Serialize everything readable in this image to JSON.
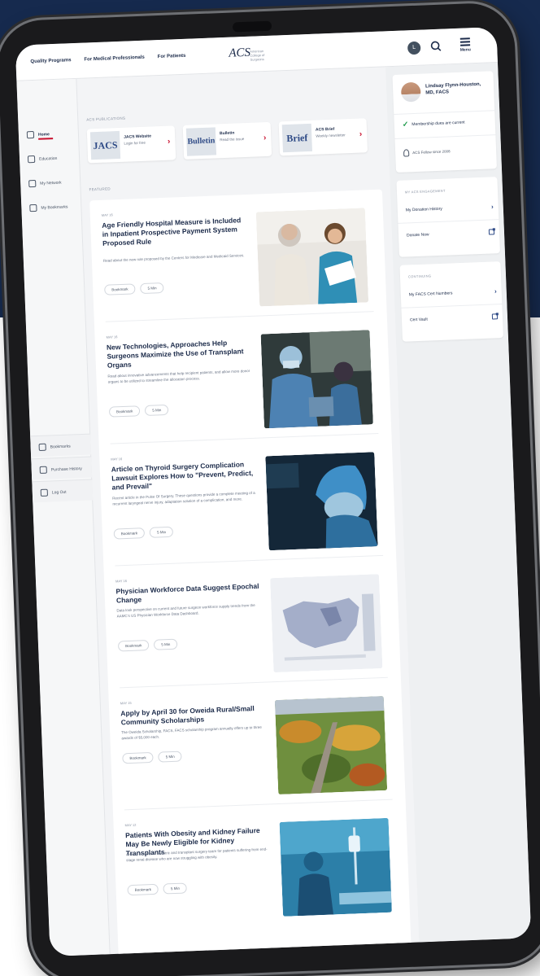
{
  "topnav": {
    "links": [
      "Quality Programs",
      "For Medical Professionals",
      "For Patients"
    ],
    "logo": "ACS",
    "logo_sub": "American College of Surgeons",
    "avatar_initial": "L",
    "menu_label": "Menu"
  },
  "sidebar": {
    "items": [
      {
        "label": "Home",
        "icon": "home-icon"
      },
      {
        "label": "Education",
        "icon": "education-icon"
      },
      {
        "label": "My Network",
        "icon": "network-icon"
      },
      {
        "label": "My Bookmarks",
        "icon": "bookmark-icon"
      }
    ],
    "lower_items": [
      {
        "label": "Bookmarks",
        "icon": "bookmark-icon"
      },
      {
        "label": "Purchase History",
        "icon": "history-icon"
      },
      {
        "label": "Log Out",
        "icon": "logout-icon"
      }
    ]
  },
  "main": {
    "publications_label": "ACS PUBLICATIONS",
    "publications": [
      {
        "cover": "JACS",
        "title": "JACS Website",
        "subtitle": "Login for free"
      },
      {
        "cover": "Bulletin",
        "title": "Bulletin",
        "subtitle": "Read the issue"
      },
      {
        "cover": "Brief",
        "title": "ACS Brief",
        "subtitle": "Weekly newsletter"
      }
    ],
    "featured_label": "FEATURED",
    "articles": [
      {
        "date": "MAY 16",
        "title": "Age Friendly Hospital Measure is Included in Inpatient Prospective Payment System Proposed Rule",
        "desc": "Read about the new rule proposed by the Centers for Medicare and Medicaid Services.",
        "bookmark": "Bookmark",
        "read": "5 Min"
      },
      {
        "date": "MAY 16",
        "title": "New Technologies, Approaches Help Surgeons Maximize the Use of Transplant Organs",
        "desc": "Read about innovative advancements that help recipient patients, and allow more donor organs to be utilized to streamline the allocation process.",
        "bookmark": "Bookmark",
        "read": "5 Min"
      },
      {
        "date": "MAY 16",
        "title": "Article on Thyroid Surgery Complication Lawsuit Explores How to \"Prevent, Predict, and Prevail\"",
        "desc": "Recent article in the Pulse Of Surgery. These questions provide a complete meeting of a recurrent laryngeal nerve injury, adaptation solution of a complication, and more.",
        "bookmark": "Bookmark",
        "read": "5 Min"
      },
      {
        "date": "MAY 16",
        "title": "Physician Workforce Data Suggest Epochal Change",
        "desc": "Data look perspective on current and future surgeon workforce supply trends from the AAMC's US Physician Workforce Data Dashboard.",
        "bookmark": "Bookmark",
        "read": "5 Min"
      },
      {
        "date": "MAY 15",
        "title": "Apply by April 30 for Oweida Rural/Small Community Scholarships",
        "desc": "The Oweida Scholarship, FACS, FACS scholarship program annually offers up to three awards of $5,000 each.",
        "bookmark": "Bookmark",
        "read": "5 Min"
      },
      {
        "date": "MAY 12",
        "title": "Patients With Obesity and Kidney Failure May Be Newly Eligible for Kidney Transplants",
        "desc": "A study between a bariatric and transplant surgery team for patients suffering from end-stage renal disease who are now struggling with obesity.",
        "bookmark": "Bookmark",
        "read": "5 Min"
      }
    ]
  },
  "rsidebar": {
    "profile_name": "Lindsay Flynn-Houston, MD, FACS",
    "membership_status": "Membership dues are current",
    "fellow_since": "ACS Fellow since 2008",
    "engagement_label": "MY ACS ENGAGEMENT",
    "engagement_items": [
      {
        "label": "My Donation History",
        "kind": "chevron"
      },
      {
        "label": "Donate Now",
        "kind": "external"
      }
    ],
    "cme_label": "CONTINUING",
    "cme_items": [
      {
        "label": "My FACS Cert Numbers",
        "kind": "chevron"
      },
      {
        "label": "Cert Vault",
        "kind": "external"
      }
    ]
  },
  "colors": {
    "navy_bg": "#162a4e",
    "accent_red": "#c8102e",
    "link_blue": "#2e4a86",
    "success_green": "#1e9a4a"
  }
}
